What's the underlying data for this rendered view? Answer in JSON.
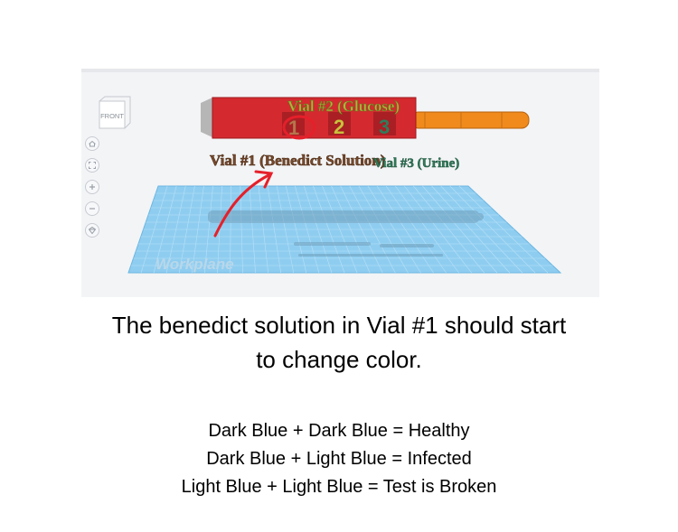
{
  "viewport": {
    "viewcube_label": "FRONT",
    "nav_icons": [
      "home-icon",
      "fit-view-icon",
      "zoom-in-icon",
      "zoom-out-icon",
      "orthographic-icon"
    ],
    "workplane_label": "Workplane",
    "labels": {
      "vial2": "Vial #2 (Glucose)",
      "vial1": "Vial #1 (Benedict Solution)",
      "vial3": "Vial #3 (Urine)",
      "num1": "1",
      "num2": "2",
      "num3": "3"
    },
    "colors": {
      "holder": "#d42a2f",
      "pipette": "#f08a1c",
      "vial1_text": "#7a4a2b",
      "vial2_text": "#b5b33a",
      "vial3_text": "#2f7d5b",
      "annotation": "#e5202a",
      "workplane": "#8fcdf0"
    }
  },
  "caption": {
    "line1": "The benedict solution in Vial #1 should start",
    "line2": "to change color."
  },
  "key": {
    "line1": "Dark Blue + Dark Blue = Healthy",
    "line2": "Dark Blue + Light Blue = Infected",
    "line3": "Light Blue + Light Blue = Test is Broken"
  }
}
